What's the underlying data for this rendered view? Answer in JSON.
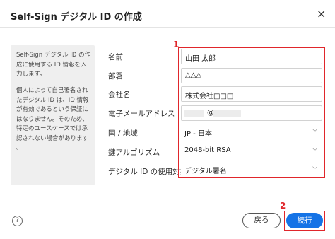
{
  "dialog": {
    "title": "Self-Sign デジタル ID の作成",
    "close_glyph": "×",
    "info": {
      "para1": "Self-Sign デジタル ID の作\n成に使用する ID 情報を入\n力します。",
      "para2": "個人によって自己署名され\nたデジタル ID は、ID 情報\nが有効であるという保証に\nはなりません。そのため、\n特定のユースケースでは承\n認されない場合があります\n。"
    },
    "fields": {
      "name": {
        "label": "名前",
        "value": "山田 太郎"
      },
      "department": {
        "label": "部署",
        "value": "△△△"
      },
      "company": {
        "label": "会社名",
        "value": "株式会社□□□"
      },
      "email": {
        "label": "電子メールアドレス",
        "value": "@"
      },
      "country": {
        "label": "国 / 地域",
        "value": "JP - 日本"
      },
      "algorithm": {
        "label": "鍵アルゴリズム",
        "value": "2048-bit RSA"
      },
      "usage": {
        "label": "デジタル ID の使用対象",
        "value": "デジタル署名"
      }
    },
    "annotations": {
      "badge1": "1",
      "badge2": "2"
    },
    "help_glyph": "?",
    "buttons": {
      "back": "戻る",
      "next": "続行"
    }
  },
  "colors": {
    "accent": "#1473e6",
    "annotation": "#e0262b",
    "info_bg": "#efefef"
  }
}
